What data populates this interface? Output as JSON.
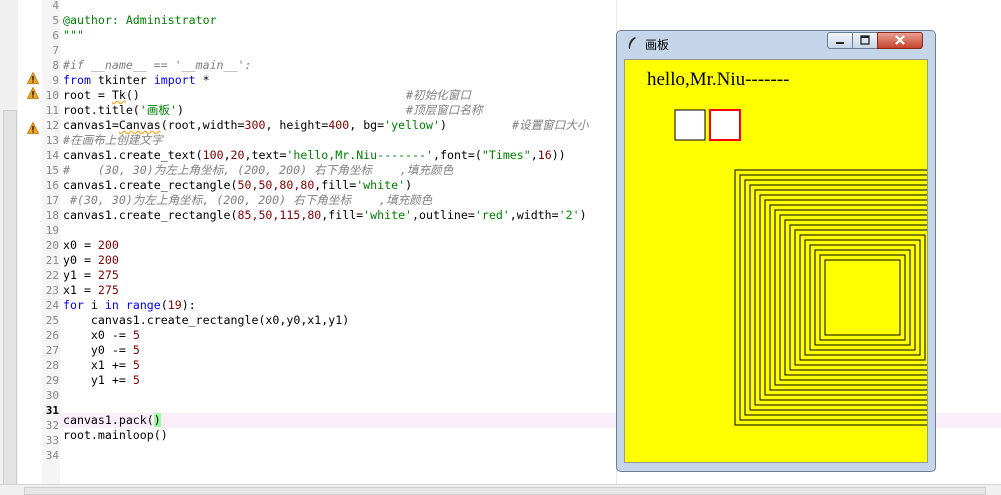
{
  "editor": {
    "line_numbers": [
      "4",
      "5",
      "6",
      "7",
      "8",
      "9",
      "10",
      "11",
      "12",
      "13",
      "14",
      "15",
      "16",
      "17",
      "18",
      "19",
      "20",
      "21",
      "22",
      "23",
      "24",
      "25",
      "26",
      "27",
      "28",
      "29",
      "30",
      "31",
      "32",
      "33",
      "34"
    ],
    "current_line": "31",
    "warning_lines": [
      "9",
      "10",
      "12"
    ],
    "code": {
      "l5": "@author: Administrator",
      "l6": "\"\"\"",
      "l8": "#if __name__ == '__main__':",
      "l9_kw1": "from",
      "l9_mid": " tkinter ",
      "l9_kw2": "import",
      "l9_end": " *",
      "l10_a": "root = ",
      "l10_b": "Tk",
      "l10_c": "()",
      "l10_cm": "#初始化窗口",
      "l11_a": "root.title(",
      "l11_str": "'画板'",
      "l11_b": ")",
      "l11_cm": "#顶层窗口名称",
      "l12_a": "canvas1=",
      "l12_b": "Canvas",
      "l12_c": "(root,width=",
      "l12_n1": "300",
      "l12_d": ", height=",
      "l12_n2": "400",
      "l12_e": ", bg=",
      "l12_str": "'yellow'",
      "l12_f": ")",
      "l12_cm": "#设置窗口大小",
      "l13": "#在画布上创建文字",
      "l14_a": "canvas1.create_text(",
      "l14_n1": "100",
      "l14_b": ",",
      "l14_n2": "20",
      "l14_c": ",text=",
      "l14_str": "'hello,Mr.Niu-------'",
      "l14_d": ",font=(",
      "l14_str2": "\"Times\"",
      "l14_e": ",",
      "l14_n3": "16",
      "l14_f": "))",
      "l15": "#    (30, 30)为左上角坐标, (200, 200) 右下角坐标    ,填充颜色",
      "l16_a": "canvas1.create_rectangle(",
      "l16_n": "50,50,80,80",
      "l16_b": ",fill=",
      "l16_str": "'white'",
      "l16_c": ")",
      "l17": " #(30, 30)为左上角坐标, (200, 200) 右下角坐标    ,填充颜色",
      "l18_a": "canvas1.create_rectangle(",
      "l18_n": "85,50,115,80",
      "l18_b": ",fill=",
      "l18_str1": "'white'",
      "l18_c": ",outline=",
      "l18_str2": "'red'",
      "l18_d": ",width=",
      "l18_str3": "'2'",
      "l18_e": ")",
      "l20_a": "x0 = ",
      "l20_n": "200",
      "l21_a": "y0 = ",
      "l21_n": "200",
      "l22_a": "y1 = ",
      "l22_n": "275",
      "l23_a": "x1 = ",
      "l23_n": "275",
      "l24_kw1": "for",
      "l24_a": " i ",
      "l24_kw2": "in",
      "l24_b": " ",
      "l24_kw3": "range",
      "l24_c": "(",
      "l24_n": "19",
      "l24_d": "):",
      "l25": "    canvas1.create_rectangle(x0,y0,x1,y1)",
      "l26_a": "    x0 -= ",
      "l26_n": "5",
      "l27_a": "    y0 -= ",
      "l27_n": "5",
      "l28_a": "    x1 += ",
      "l28_n": "5",
      "l29_a": "    y1 += ",
      "l29_n": "5",
      "l31_a": "canvas1.pack(",
      "l31_b": ")",
      "l32": "root.mainloop()"
    }
  },
  "tk_window": {
    "title": "画板",
    "canvas_bg": "#ffff00",
    "text": "hello,Mr.Niu-------",
    "rect_count": 19
  },
  "colors": {
    "keyword": "#0000ff",
    "string": "#008000",
    "number": "#800000",
    "comment": "#808080",
    "outline_red": "#ff0000"
  }
}
